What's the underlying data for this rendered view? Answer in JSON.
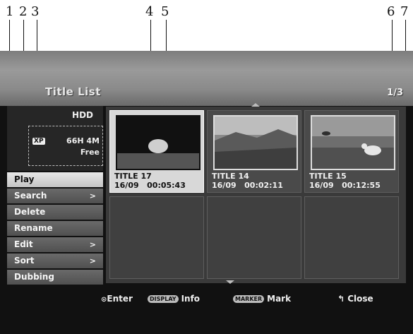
{
  "callouts": [
    "1",
    "2",
    "3",
    "4",
    "5",
    "6",
    "7"
  ],
  "header": {
    "title": "Title List",
    "page": "1/3"
  },
  "disk": {
    "media": "HDD",
    "mode": "XP",
    "time": "66H 4M",
    "free_label": "Free"
  },
  "menu": {
    "items": [
      {
        "label": "Play",
        "submenu": false
      },
      {
        "label": "Search",
        "submenu": true
      },
      {
        "label": "Delete",
        "submenu": false
      },
      {
        "label": "Rename",
        "submenu": false
      },
      {
        "label": "Edit",
        "submenu": true
      },
      {
        "label": "Sort",
        "submenu": true
      },
      {
        "label": "Dubbing",
        "submenu": false
      }
    ],
    "arrow": ">"
  },
  "titles": [
    {
      "title": "TITLE 17",
      "date": "16/09",
      "duration": "00:05:43"
    },
    {
      "title": "TITLE 14",
      "date": "16/09",
      "duration": "00:02:11"
    },
    {
      "title": "TITLE 15",
      "date": "16/09",
      "duration": "00:12:55"
    }
  ],
  "help": {
    "enter": "Enter",
    "display_key": "DISPLAY",
    "info": "Info",
    "marker_key": "MARKER",
    "mark": "Mark",
    "close": "Close"
  }
}
